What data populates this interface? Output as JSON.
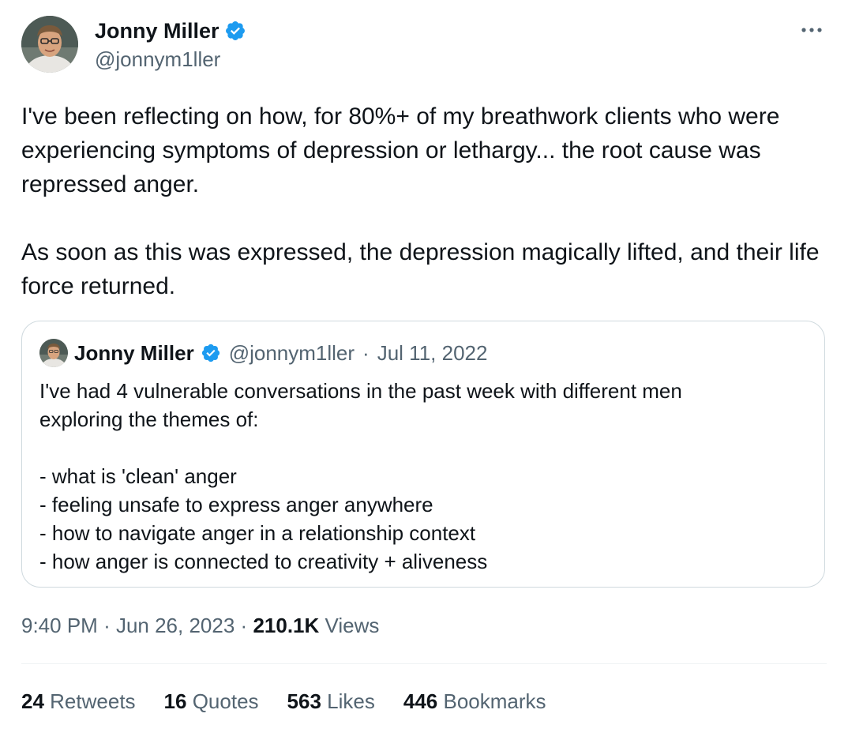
{
  "author": {
    "name": "Jonny Miller",
    "handle": "@jonnym1ller"
  },
  "tweet": {
    "paragraphs": [
      "I've been reflecting on how, for 80%+ of my breathwork clients who were experiencing symptoms of depression or lethargy... the root cause was repressed anger.",
      "As soon as this was expressed, the depression magically lifted, and their life force returned."
    ],
    "time": "9:40 PM",
    "date": "Jun 26, 2023",
    "views_count": "210.1K",
    "views_label": "Views"
  },
  "quote": {
    "name": "Jonny Miller",
    "handle": "@jonnym1ller",
    "date": "Jul 11, 2022",
    "lines": [
      "I've had 4 vulnerable conversations in the past week with different men",
      "exploring the themes of:",
      "",
      "- what is 'clean' anger",
      "- feeling unsafe to express anger anywhere",
      "- how to navigate anger in a relationship context",
      "- how anger is connected to creativity + aliveness"
    ]
  },
  "stats": [
    {
      "count": "24",
      "label": "Retweets"
    },
    {
      "count": "16",
      "label": "Quotes"
    },
    {
      "count": "563",
      "label": "Likes"
    },
    {
      "count": "446",
      "label": "Bookmarks"
    }
  ],
  "icons": {
    "verified": "verified-badge-icon",
    "more": "more-options-icon"
  },
  "colors": {
    "verified": "#1d9bf0",
    "secondary_text": "#536471",
    "primary_text": "#0f1419",
    "border": "#cfd9de"
  }
}
